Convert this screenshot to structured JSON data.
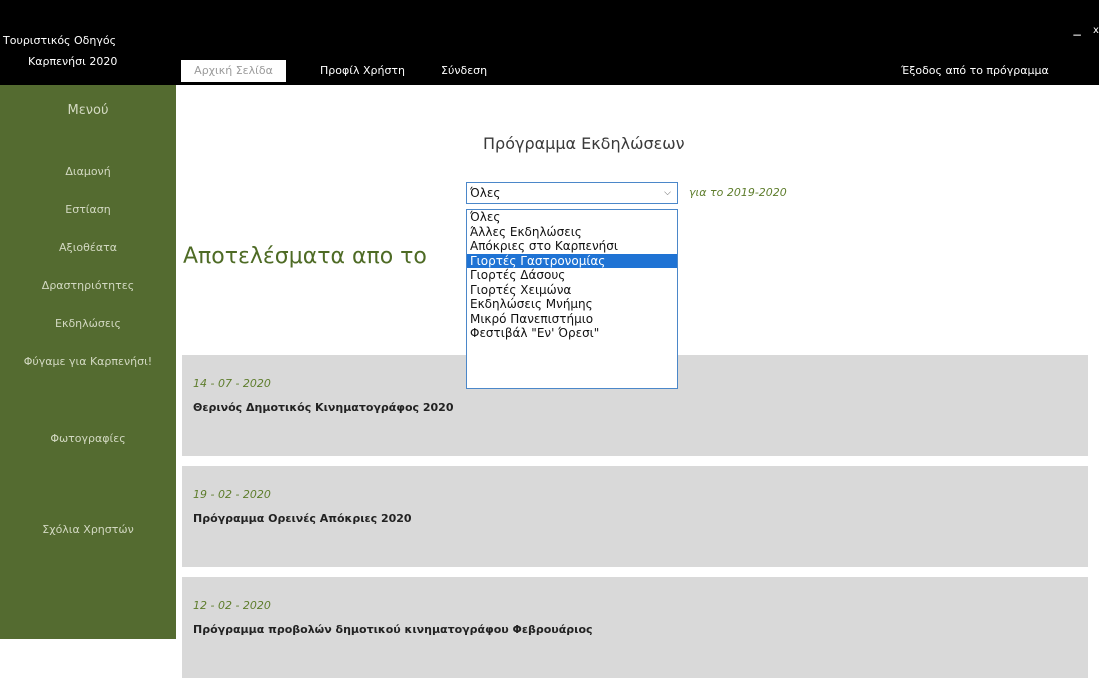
{
  "app": {
    "title_line1": "Τουριστικός Οδηγός",
    "title_line2": "Καρπενήσι 2020",
    "minimize_icon": "−",
    "close_icon": "x"
  },
  "nav": {
    "home": "Αρχική Σελίδα",
    "profile": "Προφίλ Χρήστη",
    "login": "Σύνδεση",
    "exit": "Έξοδος από το πρόγραμμα"
  },
  "sidebar": {
    "menu_title": "Μενού",
    "items": [
      "Διαμονή",
      "Εστίαση",
      "Αξιοθέατα",
      "Δραστηριότητες",
      "Εκδηλώσεις",
      "Φύγαμε για Καρπενήσι!",
      "Φωτογραφίες",
      "Σχόλια Χρηστών"
    ]
  },
  "main": {
    "heading": "Πρόγραμμα Εκδηλώσεων",
    "results_heading": "Αποτελέσματα απο το",
    "filter": {
      "selected": "Όλες",
      "year_label": "για το 2019-2020",
      "options": [
        "Όλες",
        "Άλλες Εκδηλώσεις",
        "Απόκριες στο Καρπενήσι",
        "Γιορτές Γαστρονομίας",
        "Γιορτές Δάσους",
        "Γιορτές Χειμώνα",
        "Εκδηλώσεις Μνήμης",
        "Μικρό Πανεπιστήμιο",
        "Φεστιβάλ \"Εν' Όρεσι\""
      ],
      "highlighted_index": 3
    },
    "events": [
      {
        "date": "14 - 07 - 2020",
        "title": "Θερινός Δημοτικός Κινηματογράφος 2020"
      },
      {
        "date": "19 - 02 - 2020",
        "title": "Πρόγραμμα Ορεινές Απόκριες 2020"
      },
      {
        "date": "12 - 02 - 2020",
        "title": "Πρόγραμμα προβολών δημοτικού κινηματογράφου Φεβρουάριος"
      }
    ]
  },
  "colors": {
    "sidebar": "#546b30",
    "accent_green": "#5e7d2c",
    "highlight_blue": "#1f73d4"
  }
}
